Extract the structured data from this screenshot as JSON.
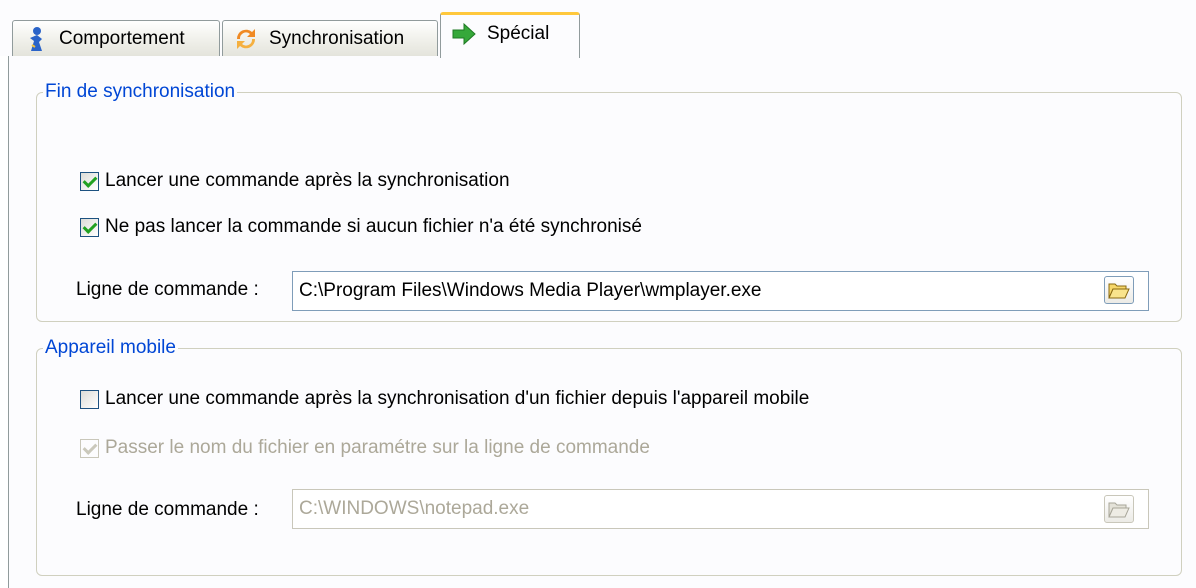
{
  "tabs": [
    {
      "label": "Comportement",
      "icon": "person-icon",
      "active": false
    },
    {
      "label": "Synchronisation",
      "icon": "sync-icon",
      "active": false
    },
    {
      "label": "Spécial",
      "icon": "arrow-right-icon",
      "active": true
    }
  ],
  "sync_end": {
    "title": "Fin de synchronisation",
    "run_command_label": "Lancer une commande après la synchronisation",
    "run_command_checked": true,
    "skip_if_none_label": "Ne pas lancer la commande si aucun fichier n'a été synchronisé",
    "skip_if_none_checked": true,
    "command_line_label": "Ligne de commande :",
    "command_line_value": "C:\\Program Files\\Windows Media Player\\wmplayer.exe"
  },
  "mobile": {
    "title": "Appareil mobile",
    "run_command_label": "Lancer une commande après la synchronisation d'un fichier depuis l'appareil mobile",
    "run_command_checked": false,
    "pass_filename_label": "Passer le nom du fichier en paramétre sur la ligne de commande",
    "pass_filename_checked": true,
    "pass_filename_disabled": true,
    "command_line_label": "Ligne de commande :",
    "command_line_value": "C:\\WINDOWS\\notepad.exe"
  },
  "colors": {
    "group_title": "#0046d5",
    "active_tab_accent": "#ffc83c",
    "disabled_text": "#aca899"
  }
}
